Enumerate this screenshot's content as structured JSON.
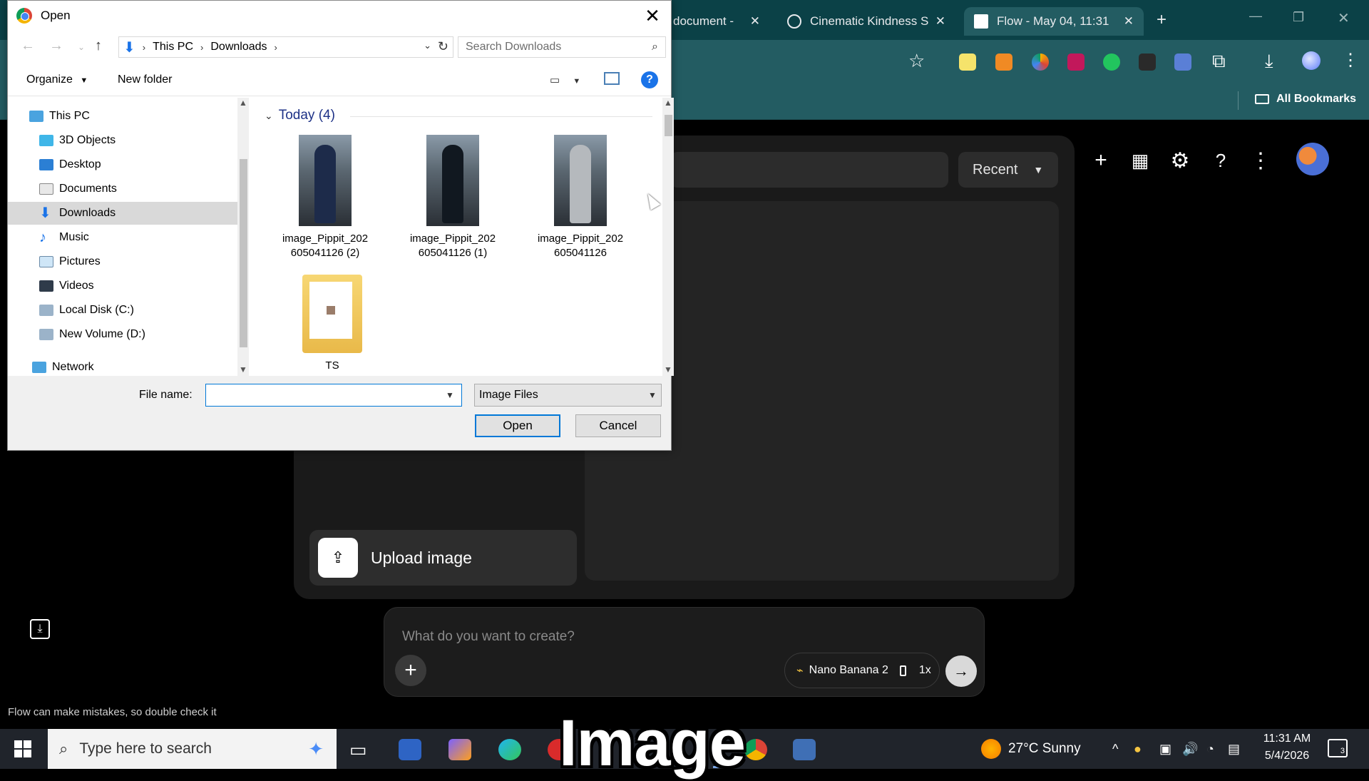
{
  "browser": {
    "tabs": [
      {
        "title": "document -",
        "active": false
      },
      {
        "title": "Cinematic Kindness S",
        "active": false
      },
      {
        "title": "Flow - May 04, 11:31",
        "active": true
      }
    ],
    "bookmarks_label": "All Bookmarks",
    "colors": {
      "tabbar": "#0b4147",
      "toolbar": "#235c62"
    }
  },
  "flow": {
    "recent_label": "Recent",
    "upload_label": "Upload image",
    "prompt_placeholder": "What do you want to create?",
    "model_label": "Nano Banana 2",
    "multiplier": "1x",
    "disclaimer": "Flow can make mistakes, so double check it"
  },
  "dialog": {
    "title": "Open",
    "breadcrumb": [
      "This PC",
      "Downloads"
    ],
    "search_placeholder": "Search Downloads",
    "organize_label": "Organize",
    "new_folder_label": "New folder",
    "tree": [
      {
        "label": "This PC",
        "icon": "this-pc-icon"
      },
      {
        "label": "3D Objects",
        "icon": "3d-objects-icon"
      },
      {
        "label": "Desktop",
        "icon": "desktop-icon"
      },
      {
        "label": "Documents",
        "icon": "documents-icon"
      },
      {
        "label": "Downloads",
        "icon": "downloads-icon",
        "selected": true
      },
      {
        "label": "Music",
        "icon": "music-icon"
      },
      {
        "label": "Pictures",
        "icon": "pictures-icon"
      },
      {
        "label": "Videos",
        "icon": "videos-icon"
      },
      {
        "label": "Local Disk (C:)",
        "icon": "local-disk-icon"
      },
      {
        "label": "New Volume (D:)",
        "icon": "volume-icon"
      },
      {
        "label": "Network",
        "icon": "network-icon"
      }
    ],
    "group_header": "Today (4)",
    "files": [
      {
        "line1": "image_Pippit_202",
        "line2": "605041126 (2)",
        "type": "image"
      },
      {
        "line1": "image_Pippit_202",
        "line2": "605041126 (1)",
        "type": "image"
      },
      {
        "line1": "image_Pippit_202",
        "line2": "605041126",
        "type": "image"
      },
      {
        "line1": "TS",
        "line2": "",
        "type": "folder"
      }
    ],
    "file_name_label": "File name:",
    "file_name_value": "",
    "file_type": "Image Files",
    "open_label": "Open",
    "cancel_label": "Cancel"
  },
  "taskbar": {
    "search_placeholder": "Type here to search",
    "weather": "27°C  Sunny",
    "time": "11:31 AM",
    "date": "5/4/2026",
    "notifications": "3"
  },
  "caption": "Image"
}
